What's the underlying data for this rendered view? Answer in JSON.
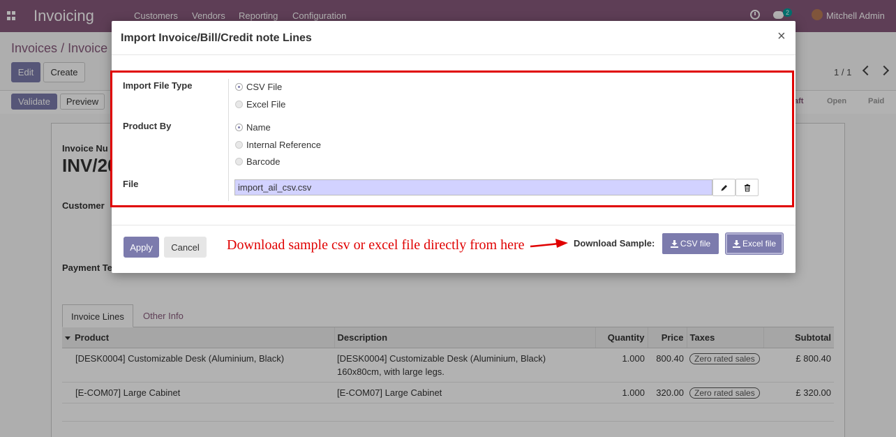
{
  "navbar": {
    "brand": "Invoicing",
    "menu": [
      "Customers",
      "Vendors",
      "Reporting",
      "Configuration"
    ],
    "chat_count": "2",
    "user": "Mitchell Admin"
  },
  "control": {
    "breadcrumb_root": "Invoices",
    "breadcrumb_sep": "/",
    "breadcrumb_current": "Invoice",
    "edit_label": "Edit",
    "create_label": "Create",
    "pager": "1 / 1",
    "validate_label": "Validate",
    "preview_label": "Preview",
    "status_steps": [
      "aft",
      "Open",
      "Paid"
    ]
  },
  "form": {
    "invoice_number_label": "Invoice Nu",
    "invoice_number": "INV/20",
    "customer_label": "Customer",
    "payment_terms_label": "Payment Te",
    "tabs": [
      "Invoice Lines",
      "Other Info"
    ],
    "columns": [
      "Product",
      "Description",
      "Quantity",
      "Price",
      "Taxes",
      "Subtotal"
    ],
    "rows": [
      {
        "product": "[DESK0004] Customizable Desk (Aluminium, Black)",
        "description_1": "[DESK0004] Customizable Desk (Aluminium, Black)",
        "description_2": "160x80cm, with large legs.",
        "quantity": "1.000",
        "price": "800.40",
        "tax": "Zero rated sales",
        "subtotal": "£ 800.40"
      },
      {
        "product": "[E-COM07] Large Cabinet",
        "description_1": "[E-COM07] Large Cabinet",
        "description_2": "",
        "quantity": "1.000",
        "price": "320.00",
        "tax": "Zero rated sales",
        "subtotal": "£ 320.00"
      }
    ]
  },
  "modal": {
    "title": "Import Invoice/Bill/Credit note Lines",
    "close": "×",
    "import_file_type_label": "Import File Type",
    "file_type_options": [
      {
        "label": "CSV File",
        "checked": true
      },
      {
        "label": "Excel File",
        "checked": false
      }
    ],
    "product_by_label": "Product By",
    "product_by_options": [
      {
        "label": "Name",
        "checked": true
      },
      {
        "label": "Internal Reference",
        "checked": false
      },
      {
        "label": "Barcode",
        "checked": false
      }
    ],
    "file_label": "File",
    "file_value": "import_ail_csv.csv",
    "apply_label": "Apply",
    "cancel_label": "Cancel",
    "annotation": "Download sample csv or excel file directly from here",
    "download_sample_label": "Download Sample:",
    "csv_btn_label": "CSV file",
    "excel_btn_label": "Excel file"
  },
  "colors": {
    "navbar": "#875a7b",
    "primary": "#7c7bad",
    "annotation_red": "#e00000",
    "file_input_bg": "#d2d2ff"
  }
}
